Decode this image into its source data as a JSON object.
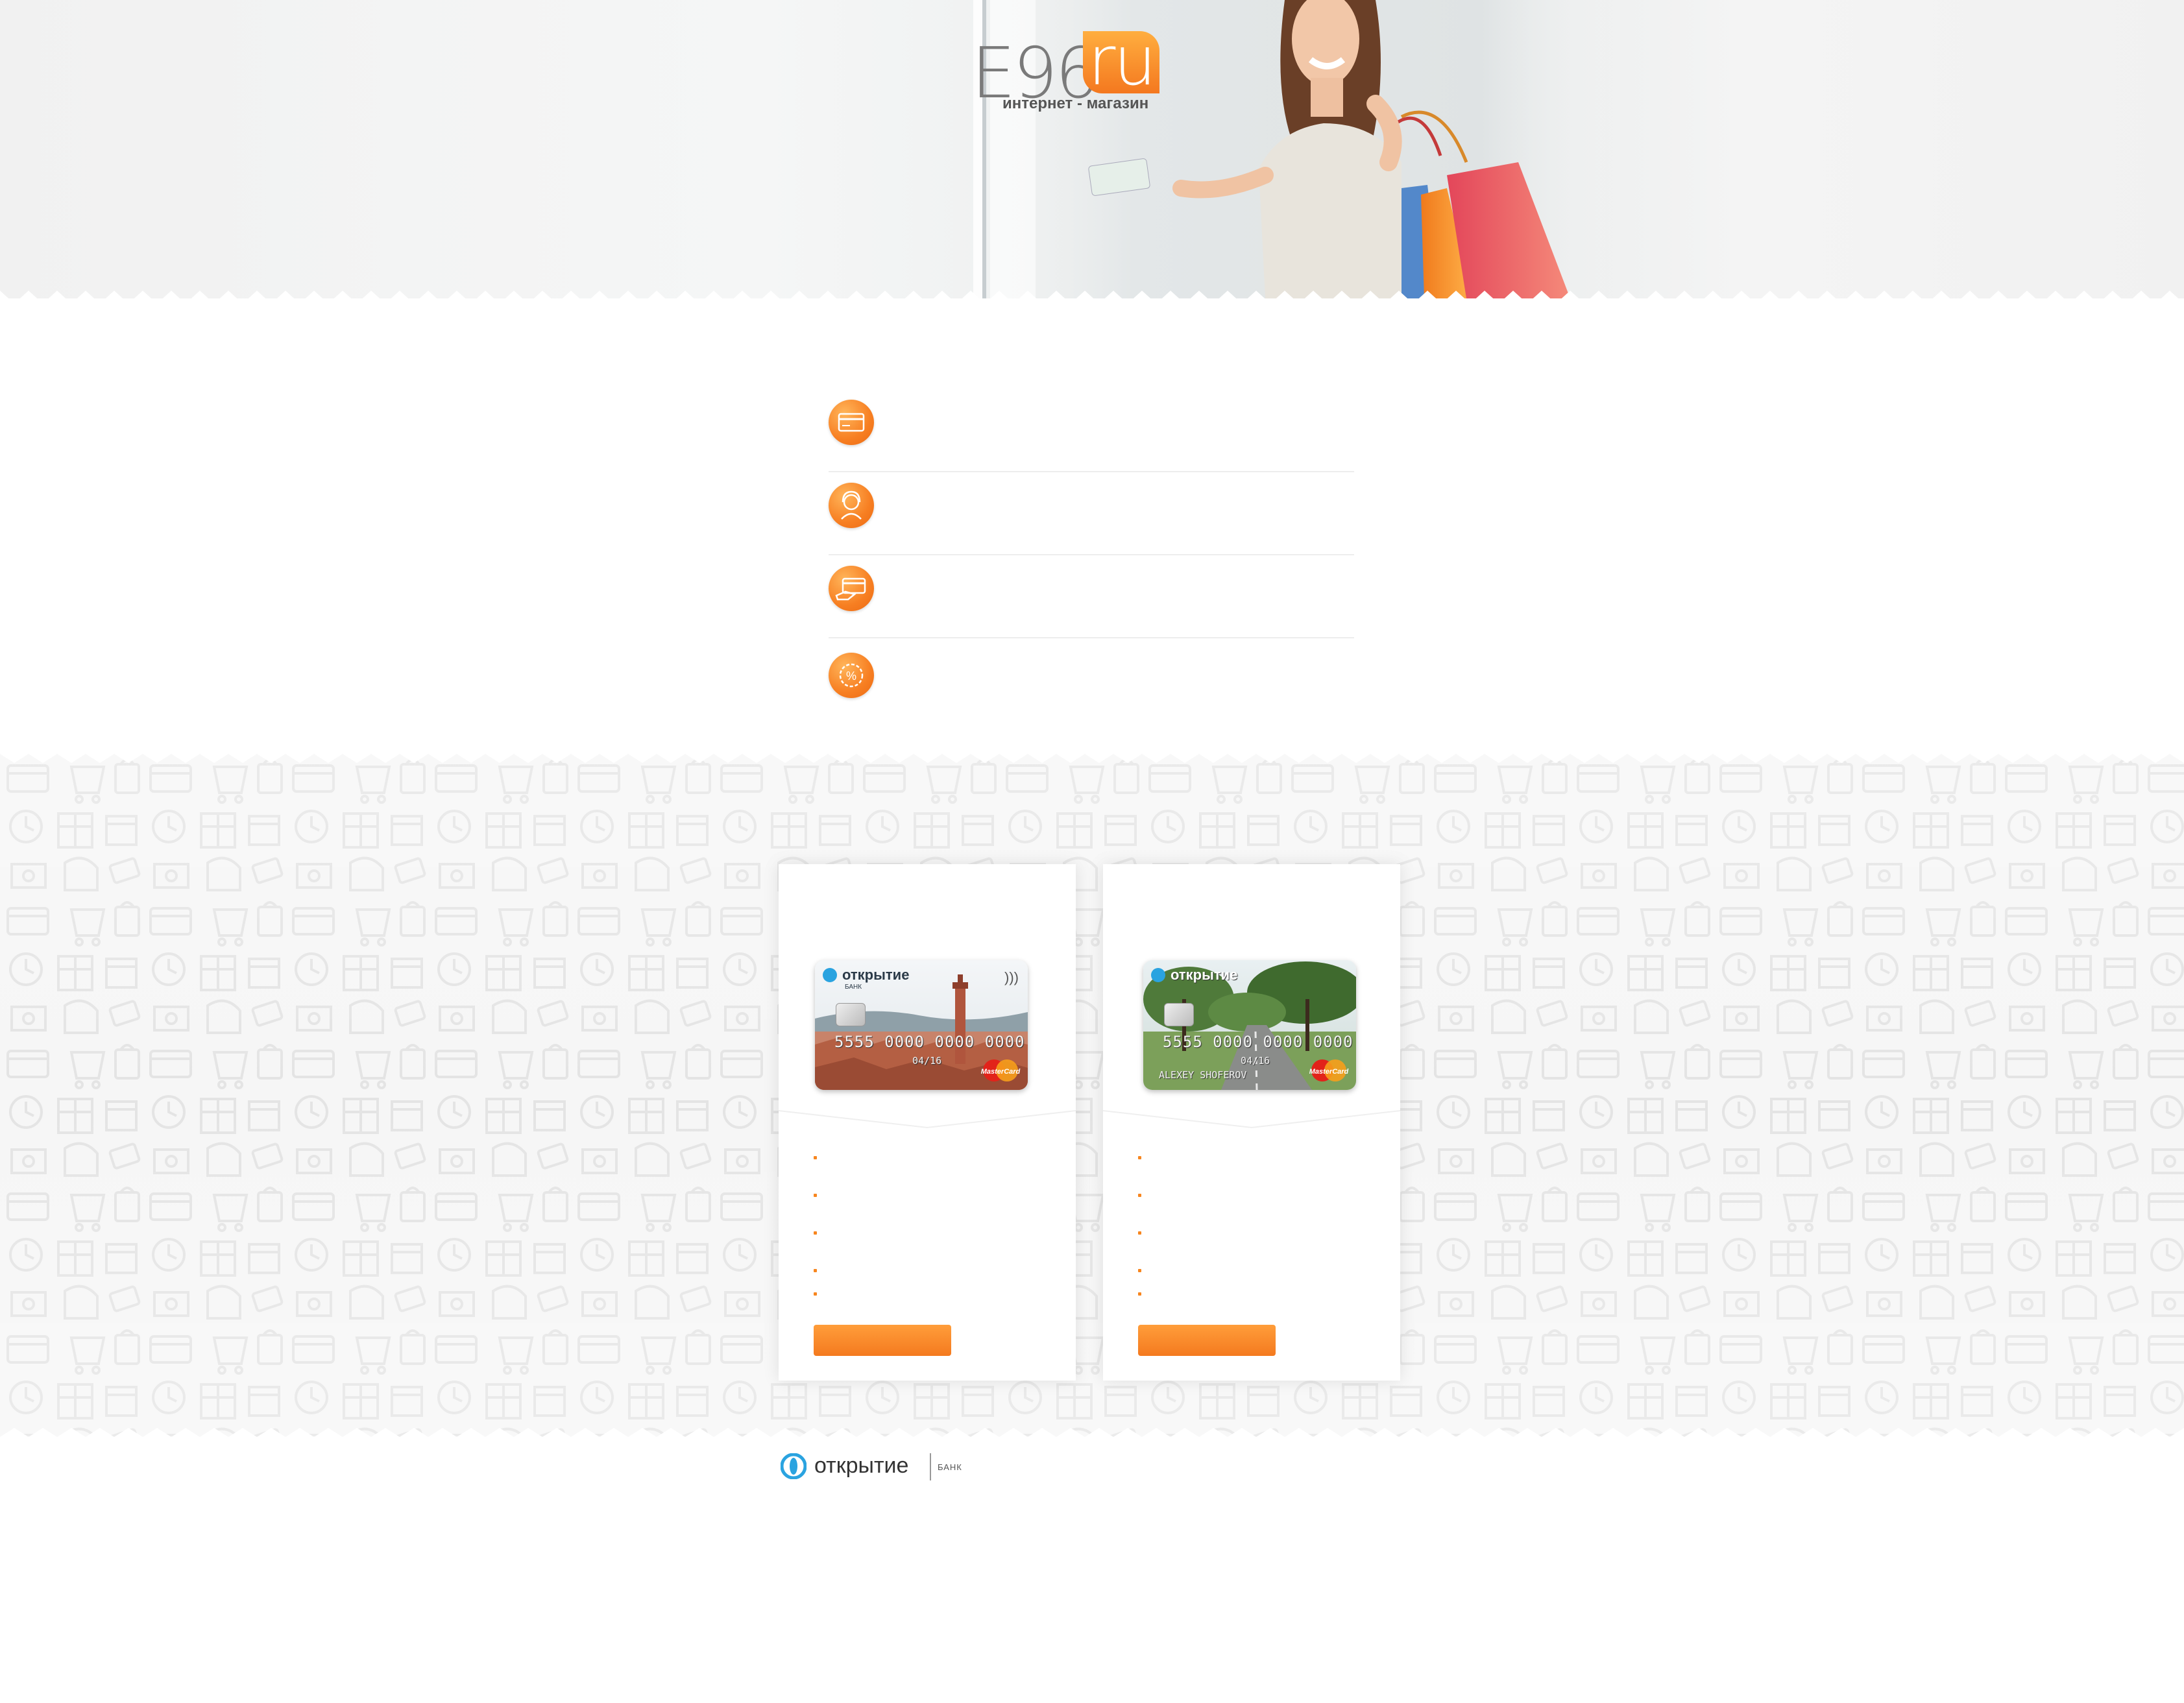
{
  "header": {
    "logo_main": "E96",
    "logo_accent": "ru",
    "logo_tagline": "интернет - магазин"
  },
  "features": [
    {
      "icon": "credit-card-icon",
      "text": ""
    },
    {
      "icon": "support-agent-icon",
      "text": ""
    },
    {
      "icon": "card-in-hand-icon",
      "text": ""
    },
    {
      "icon": "percent-badge-icon",
      "text": ""
    }
  ],
  "cards": [
    {
      "title": "",
      "card": {
        "brand": "открытие",
        "brand_sub": "БАНК",
        "number": "5555 0000 0000 0000",
        "expiry": "04/16",
        "holder": "",
        "network": "MasterCard"
      },
      "bullets": [
        "",
        "",
        "",
        "",
        ""
      ],
      "button_label": ""
    },
    {
      "title": "",
      "card": {
        "brand": "открытие",
        "brand_sub": "",
        "number": "5555 0000 0000 0000",
        "expiry": "04/16",
        "holder": "ALEXEY SHOFEROV",
        "network": "MasterCard"
      },
      "bullets": [
        "",
        "",
        "",
        "",
        ""
      ],
      "button_label": ""
    }
  ],
  "footer": {
    "bank_name": "открытие",
    "bank_label": "БАНК"
  },
  "colors": {
    "accent": "#f7861f",
    "accent_light": "#ffae3f",
    "bank_blue": "#2aa3e0"
  }
}
